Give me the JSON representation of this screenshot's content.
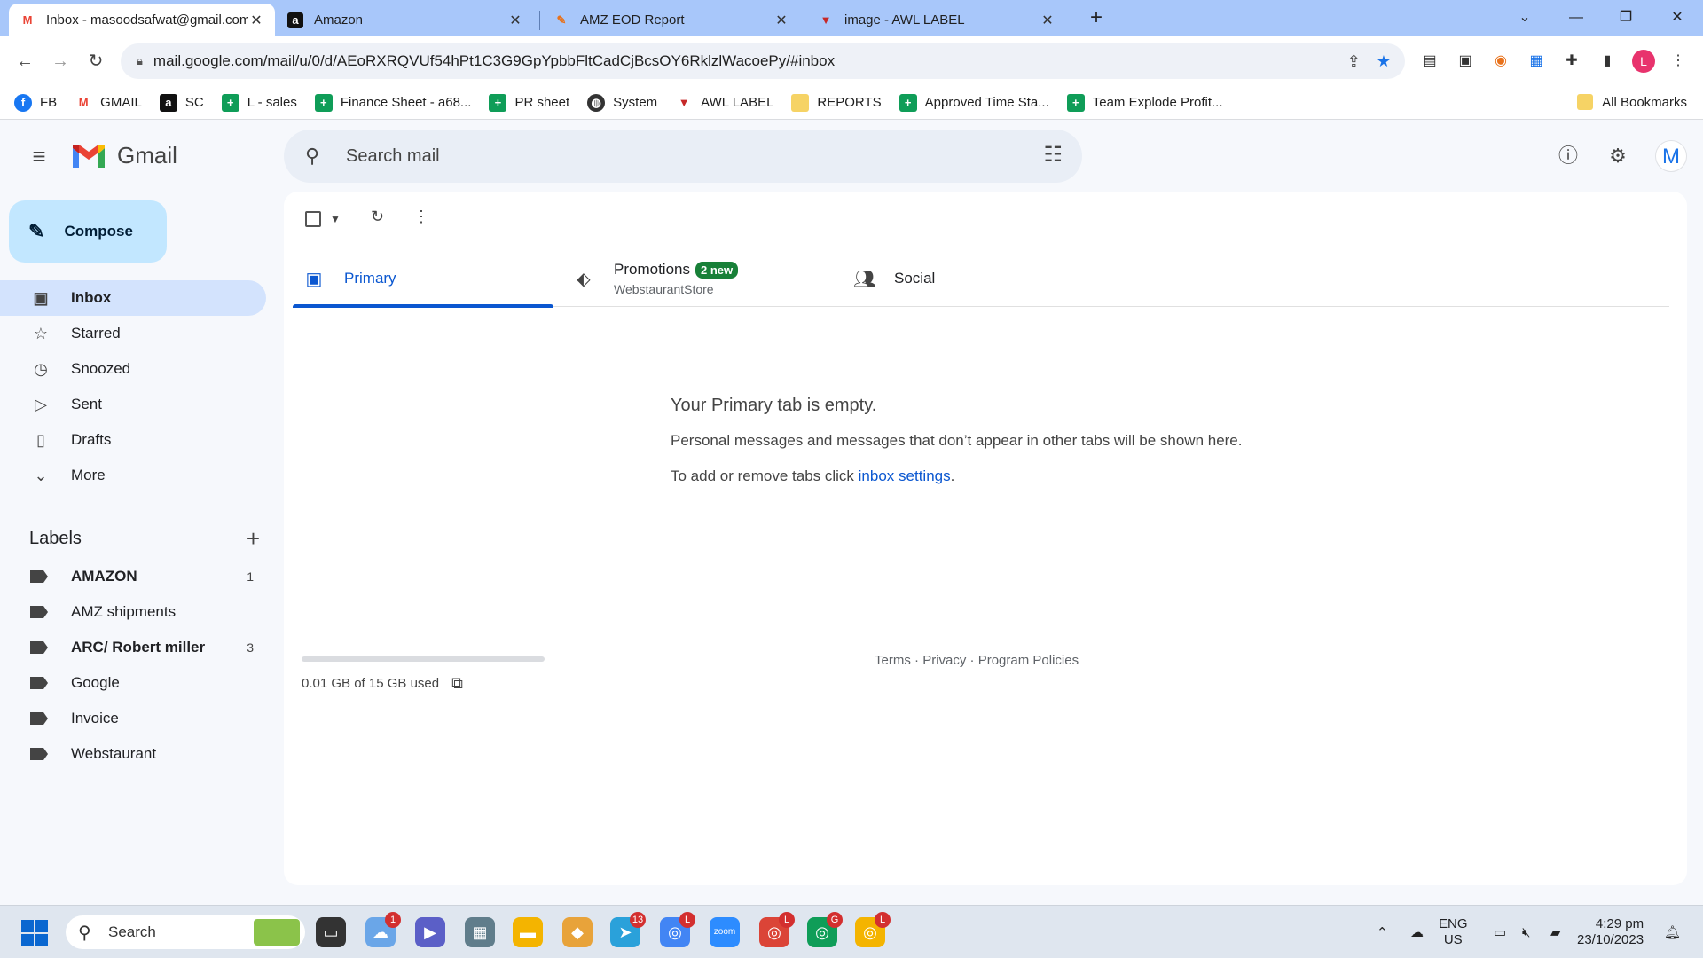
{
  "browser": {
    "tabs": [
      {
        "title": "Inbox - masoodsafwat@gmail.com",
        "active": true
      },
      {
        "title": "Amazon",
        "active": false
      },
      {
        "title": "AMZ EOD Report",
        "active": false
      },
      {
        "title": "image - AWL LABEL",
        "active": false
      }
    ],
    "url": "mail.google.com/mail/u/0/d/AEoRXRQVUf54hPt1C3G9GpYpbbFltCadCjBcsOY6RklzlWacoePy/#inbox",
    "profile_initial": "L",
    "bookmarks": [
      "FB",
      "GMAIL",
      "SC",
      "L - sales",
      "Finance Sheet - a68...",
      "PR sheet",
      "System",
      "AWL LABEL",
      "REPORTS",
      "Approved Time Sta...",
      "Team Explode Profit..."
    ],
    "all_bookmarks": "All Bookmarks"
  },
  "gmail": {
    "logo_text": "Gmail",
    "search_placeholder": "Search mail",
    "avatar_initial": "M",
    "compose_label": "Compose",
    "nav": [
      {
        "label": "Inbox",
        "icon": "inbox-icon",
        "active": true
      },
      {
        "label": "Starred",
        "icon": "star-icon"
      },
      {
        "label": "Snoozed",
        "icon": "clock-icon"
      },
      {
        "label": "Sent",
        "icon": "send-icon"
      },
      {
        "label": "Drafts",
        "icon": "draft-icon"
      },
      {
        "label": "More",
        "icon": "chevron-down-icon"
      }
    ],
    "labels_title": "Labels",
    "labels": [
      {
        "name": "AMAZON",
        "count": "1",
        "bold": true
      },
      {
        "name": "AMZ shipments",
        "count": "",
        "bold": false
      },
      {
        "name": "ARC/ Robert miller",
        "count": "3",
        "bold": true
      },
      {
        "name": "Google",
        "count": "",
        "bold": false
      },
      {
        "name": "Invoice",
        "count": "",
        "bold": false
      },
      {
        "name": "Webstaurant",
        "count": "",
        "bold": false
      }
    ],
    "tabs": {
      "primary": "Primary",
      "promotions": "Promotions",
      "promotions_badge": "2 new",
      "promotions_sub": "WebstaurantStore",
      "social": "Social"
    },
    "empty": {
      "title": "Your Primary tab is empty.",
      "line1": "Personal messages and messages that don’t appear in other tabs will be shown here.",
      "line2_prefix": "To add or remove tabs click ",
      "line2_link": "inbox settings",
      "line2_suffix": "."
    },
    "storage": {
      "text": "0.01 GB of 15 GB used",
      "fraction": 0.001
    },
    "footer": {
      "terms": "Terms",
      "privacy": "Privacy",
      "policies": "Program Policies",
      "sep": " · "
    }
  },
  "taskbar": {
    "search_label": "Search",
    "lang": "ENG",
    "region": "US",
    "time": "4:29 pm",
    "date": "23/10/2023",
    "badges": {
      "weather": "1",
      "telegram": "13",
      "chrome_active": "L",
      "chrome2": "L",
      "chrome3": "G",
      "chrome4": "L"
    }
  }
}
